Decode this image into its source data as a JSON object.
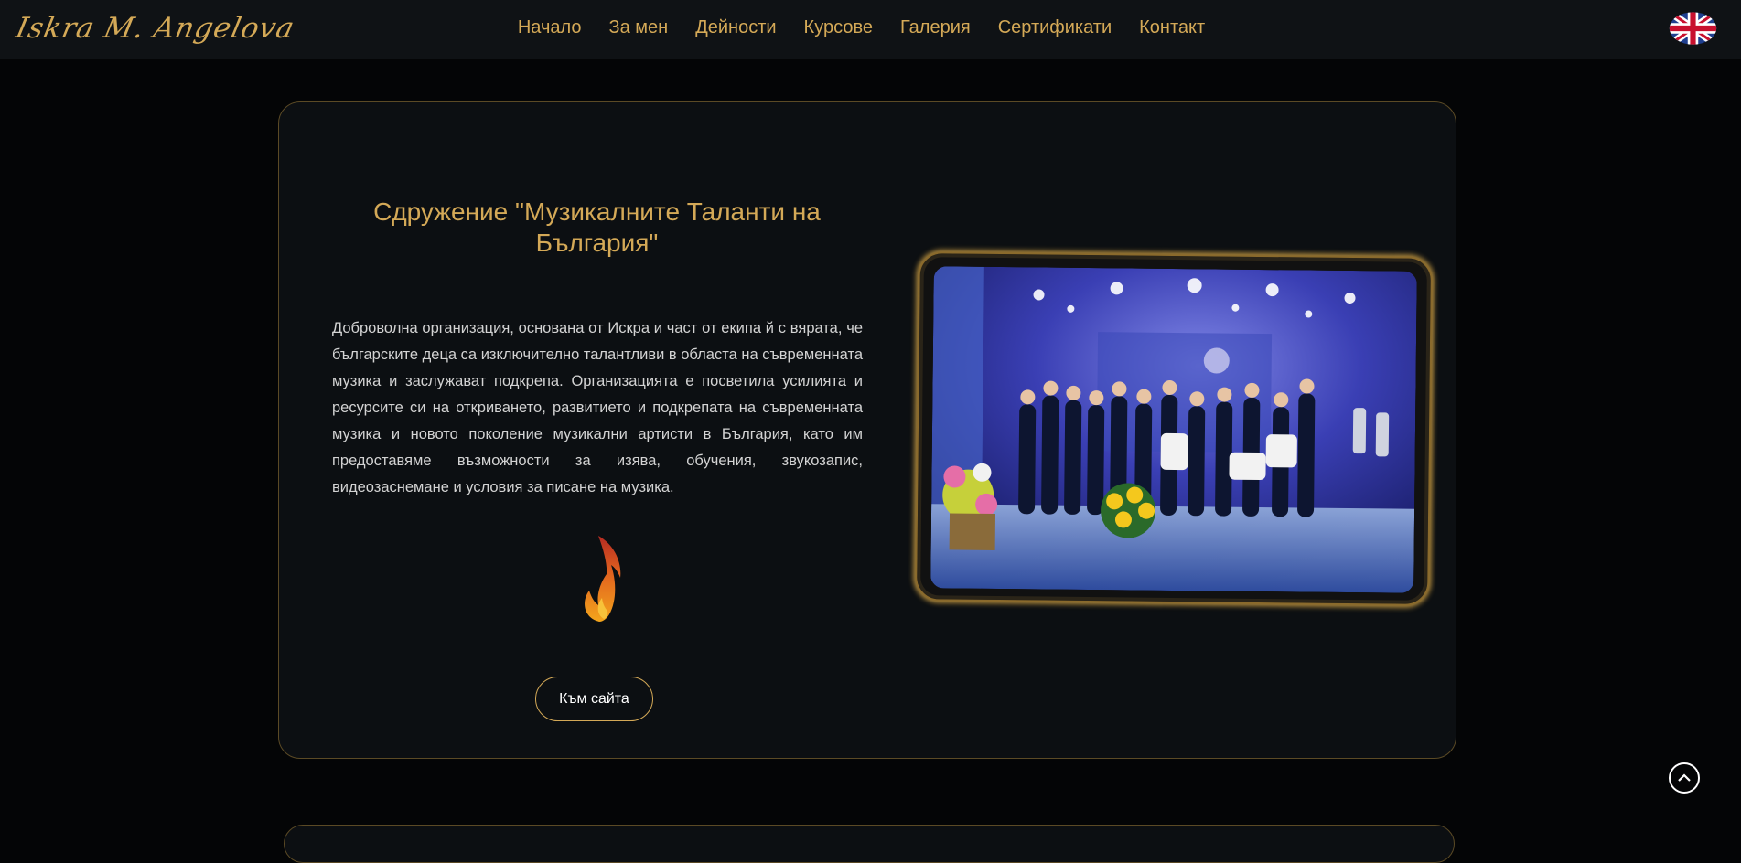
{
  "header": {
    "logo": "Iskra M. Angelova",
    "nav": [
      "Начало",
      "За мен",
      "Дейности",
      "Курсове",
      "Галерия",
      "Сертификати",
      "Контакт"
    ],
    "language_icon": "uk-flag-icon"
  },
  "section": {
    "title": "Сдружение \"Музикалните Таланти на България\"",
    "description": "Доброволна организация, основана от Искра и част от екипа й с вярата, че българските деца са изключително талантливи в областа на съвременната музика и заслужават подкрепа. Организацията е посветила усилията и ресурсите си на откриването, развитието и подкрепата на съвременната музика и новото поколение музикални артисти в България, като им предоставяме възможности за изява, обучения, звукозапис, видеозаснемане и условия за писане на музика.",
    "button": "Към сайта",
    "logo_icon": "flame-note-icon"
  },
  "scroll_top_icon": "chevron-up-icon",
  "colors": {
    "accent": "#d4a957",
    "background": "#040506",
    "card": "#0c0f12"
  }
}
